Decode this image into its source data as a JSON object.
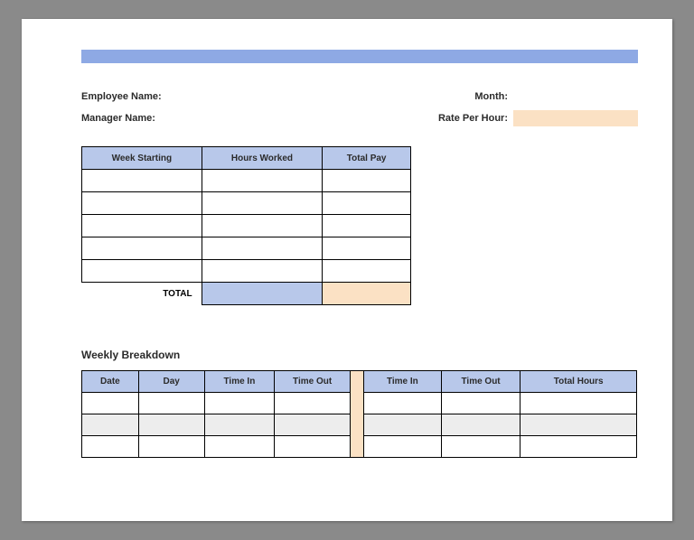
{
  "info": {
    "employee_label": "Employee Name:",
    "manager_label": "Manager Name:",
    "month_label": "Month:",
    "rate_label": "Rate Per Hour:",
    "month_value": "",
    "rate_value": ""
  },
  "summary": {
    "headers": {
      "ws": "Week Starting",
      "hw": "Hours Worked",
      "tp": "Total Pay"
    },
    "rows": [
      {
        "ws": "",
        "hw": "",
        "tp": ""
      },
      {
        "ws": "",
        "hw": "",
        "tp": ""
      },
      {
        "ws": "",
        "hw": "",
        "tp": ""
      },
      {
        "ws": "",
        "hw": "",
        "tp": ""
      },
      {
        "ws": "",
        "hw": "",
        "tp": ""
      }
    ],
    "total_label": "TOTAL",
    "total_hw": "",
    "total_tp": ""
  },
  "weekly": {
    "title": "Weekly Breakdown",
    "headers": {
      "date": "Date",
      "day": "Day",
      "tin1": "Time In",
      "tout1": "Time Out",
      "tin2": "Time In",
      "tout2": "Time Out",
      "tot": "Total Hours"
    },
    "rows": [
      {
        "date": "",
        "day": "",
        "tin1": "",
        "tout1": "",
        "tin2": "",
        "tout2": "",
        "tot": ""
      },
      {
        "date": "",
        "day": "",
        "tin1": "",
        "tout1": "",
        "tin2": "",
        "tout2": "",
        "tot": ""
      },
      {
        "date": "",
        "day": "",
        "tin1": "",
        "tout1": "",
        "tin2": "",
        "tout2": "",
        "tot": ""
      }
    ]
  }
}
